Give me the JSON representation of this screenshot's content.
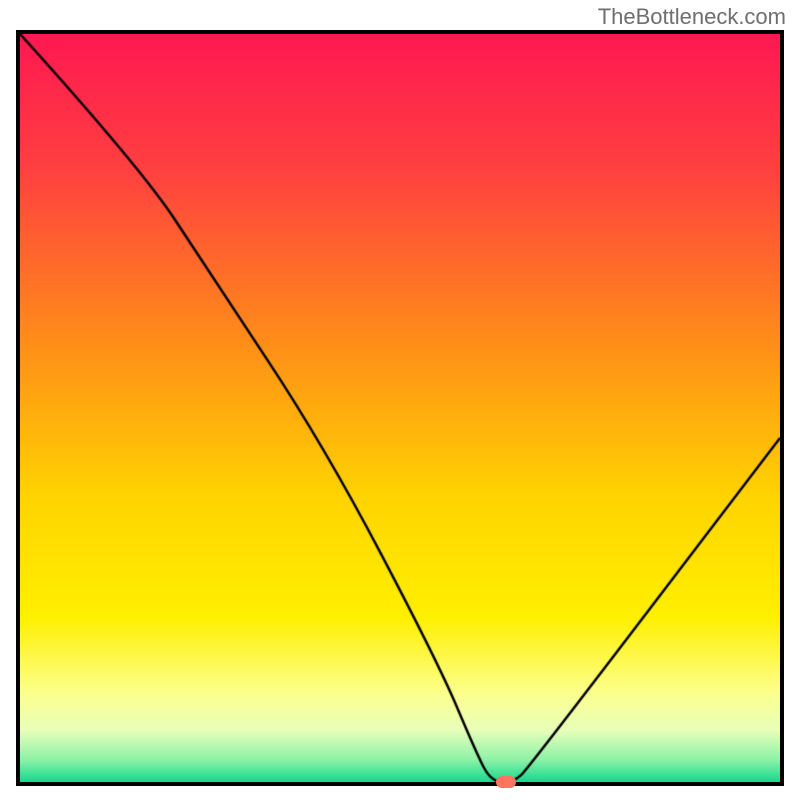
{
  "watermark": "TheBottleneck.com",
  "chart_data": {
    "type": "line",
    "title": "",
    "xlabel": "",
    "ylabel": "",
    "xlim": [
      0,
      100
    ],
    "ylim": [
      0,
      100
    ],
    "x": [
      0,
      16,
      25,
      40,
      55,
      60,
      62,
      65,
      67,
      100
    ],
    "values": [
      100,
      82,
      68,
      45,
      16,
      4,
      0,
      0,
      2,
      46
    ],
    "marker_x": 64,
    "marker_y": 0,
    "gradient_stops": [
      {
        "pos": 0.0,
        "color": "#ff1852"
      },
      {
        "pos": 0.18,
        "color": "#ff4040"
      },
      {
        "pos": 0.42,
        "color": "#ff9018"
      },
      {
        "pos": 0.62,
        "color": "#ffd400"
      },
      {
        "pos": 0.78,
        "color": "#fff000"
      },
      {
        "pos": 0.88,
        "color": "#fdff8c"
      },
      {
        "pos": 0.93,
        "color": "#e9ffba"
      },
      {
        "pos": 0.97,
        "color": "#8ff2a8"
      },
      {
        "pos": 1.0,
        "color": "#14d98e"
      }
    ]
  }
}
